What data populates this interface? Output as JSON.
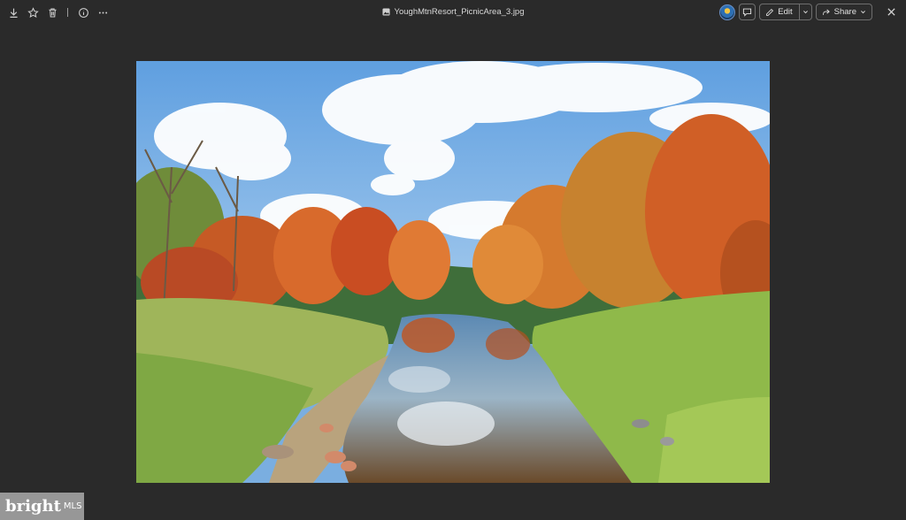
{
  "toolbar": {
    "left_icons": [
      "download-icon",
      "star-icon",
      "trash-icon",
      "info-icon",
      "more-icon"
    ],
    "filename": "YoughMtnResort_PicnicArea_3.jpg",
    "edit_label": "Edit",
    "share_label": "Share"
  },
  "photo": {
    "subject": "autumn stream landscape",
    "colors": {
      "sky": "#7aaee0",
      "foliage_orange": "#d9682a",
      "grass": "#8fb54a",
      "water": "#3f5f7a"
    }
  },
  "watermark": {
    "brand": "bright",
    "suffix": "MLS"
  }
}
